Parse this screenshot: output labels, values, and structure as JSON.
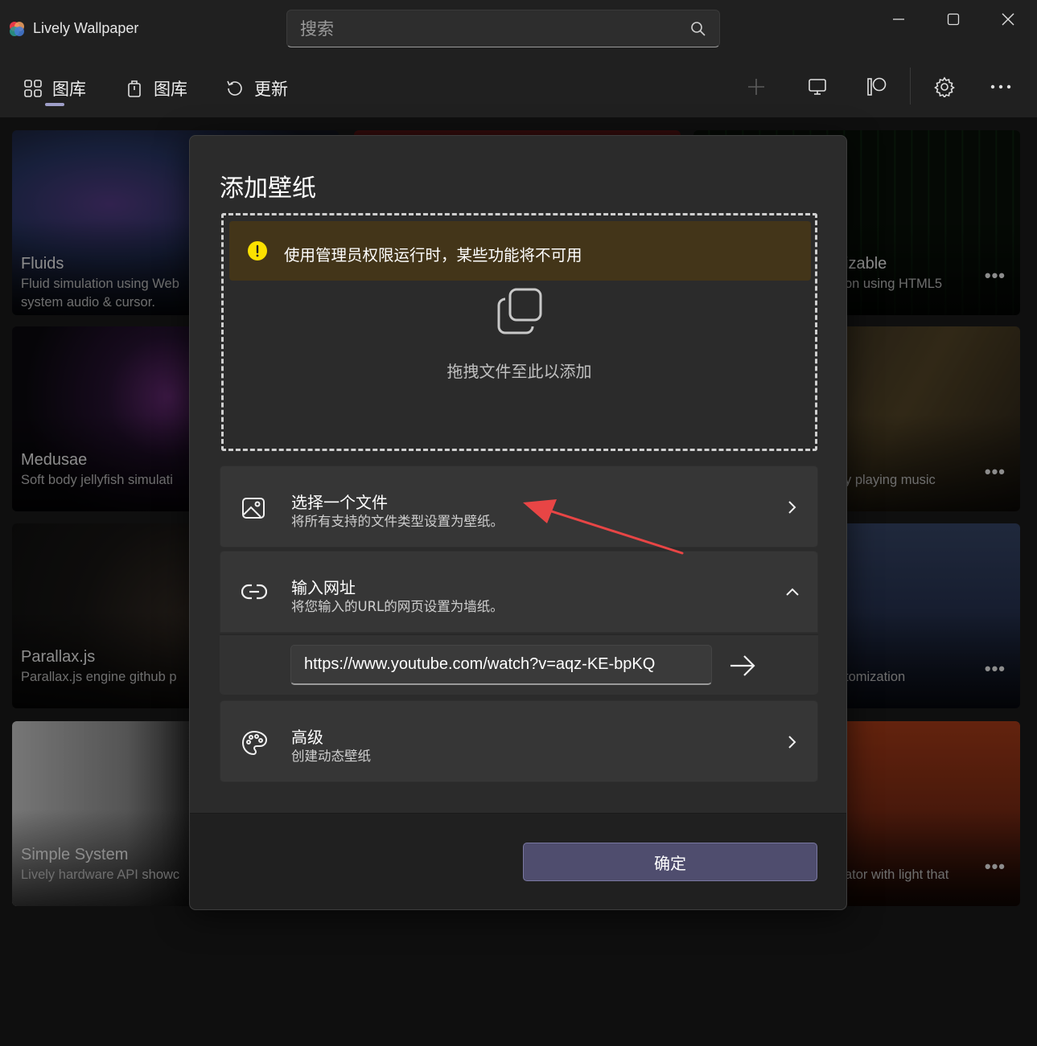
{
  "app": {
    "title": "Lively Wallpaper"
  },
  "search": {
    "placeholder": "搜索"
  },
  "nav": {
    "items": [
      {
        "label": "图库",
        "icon": "grid-icon"
      },
      {
        "label": "图库",
        "icon": "bucket-icon"
      },
      {
        "label": "更新",
        "icon": "refresh-icon"
      }
    ]
  },
  "toolbar": {
    "icons": [
      "plus-icon",
      "monitor-icon",
      "patreon-icon",
      "gear-icon",
      "more-icon"
    ]
  },
  "cards": [
    {
      "title": "Fluids",
      "desc1": "Fluid simulation using Web",
      "desc2": "system audio & cursor."
    },
    {
      "title": "izable",
      "desc1": "on using HTML5",
      "desc2": ""
    },
    {
      "title": "Medusae",
      "desc1": "Soft body jellyfish simulati",
      "desc2": ""
    },
    {
      "title": "",
      "desc1": "y playing music",
      "desc2": ""
    },
    {
      "title": "Parallax.js",
      "desc1": "Parallax.js engine github p",
      "desc2": ""
    },
    {
      "title": "",
      "desc1": "tomization",
      "desc2": ""
    },
    {
      "title": "Simple System",
      "desc1": "Lively hardware API showc",
      "desc2": ""
    },
    {
      "title": "",
      "desc1": "ator with light that",
      "desc2": ""
    }
  ],
  "dialog": {
    "title": "添加壁纸",
    "warning": "使用管理员权限运行时，某些功能将不可用",
    "drop_text": "拖拽文件至此以添加",
    "options": {
      "file": {
        "title": "选择一个文件",
        "subtitle": "将所有支持的文件类型设置为壁纸。"
      },
      "url": {
        "title": "输入网址",
        "subtitle": "将您输入的URL的网页设置为墙纸。",
        "value": "https://www.youtube.com/watch?v=aqz-KE-bpKQ"
      },
      "advanced": {
        "title": "高级",
        "subtitle": "创建动态壁纸"
      }
    },
    "ok_label": "确定"
  },
  "colors": {
    "accent": "#4f4d6e",
    "warning_bg": "#433519",
    "warning_icon": "#fce100",
    "annotation_arrow": "#e84545"
  }
}
